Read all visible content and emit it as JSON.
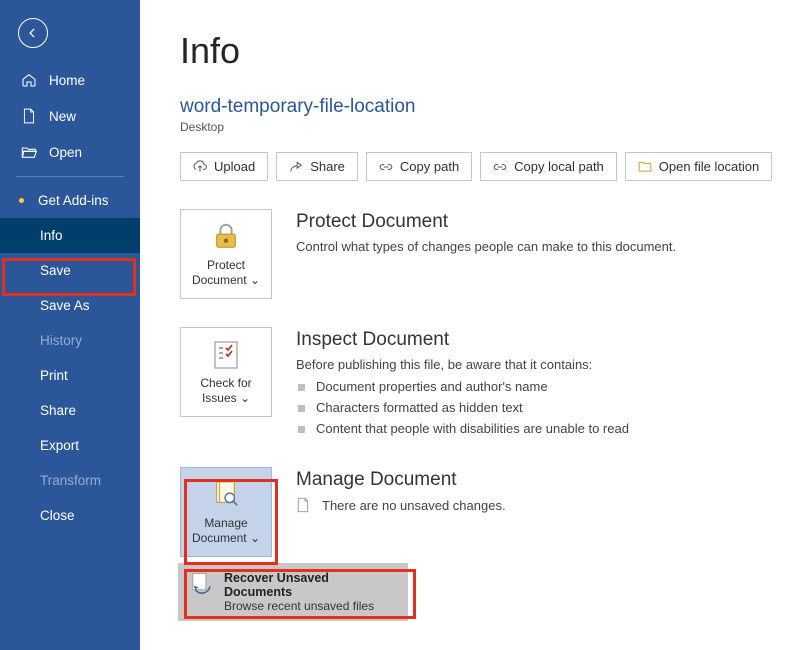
{
  "sidebar": {
    "items": [
      {
        "label": "Home"
      },
      {
        "label": "New"
      },
      {
        "label": "Open"
      },
      {
        "label": "Get Add-ins"
      },
      {
        "label": "Info"
      },
      {
        "label": "Save"
      },
      {
        "label": "Save As"
      },
      {
        "label": "History"
      },
      {
        "label": "Print"
      },
      {
        "label": "Share"
      },
      {
        "label": "Export"
      },
      {
        "label": "Transform"
      },
      {
        "label": "Close"
      }
    ]
  },
  "page": {
    "title": "Info",
    "doc_title": "word-temporary-file-location",
    "doc_location": "Desktop"
  },
  "toolbar": {
    "upload": "Upload",
    "share": "Share",
    "copy_path": "Copy path",
    "copy_local_path": "Copy local path",
    "open_location": "Open file location"
  },
  "protect": {
    "tile": "Protect Document",
    "title": "Protect Document",
    "desc": "Control what types of changes people can make to this document."
  },
  "inspect": {
    "tile": "Check for Issues",
    "title": "Inspect Document",
    "lead": "Before publishing this file, be aware that it contains:",
    "items": [
      "Document properties and author's name",
      "Characters formatted as hidden text",
      "Content that people with disabilities are unable to read"
    ]
  },
  "manage": {
    "tile": "Manage Document",
    "title": "Manage Document",
    "none": "There are no unsaved changes.",
    "recover_title": "Recover Unsaved Documents",
    "recover_sub": "Browse recent unsaved files"
  }
}
